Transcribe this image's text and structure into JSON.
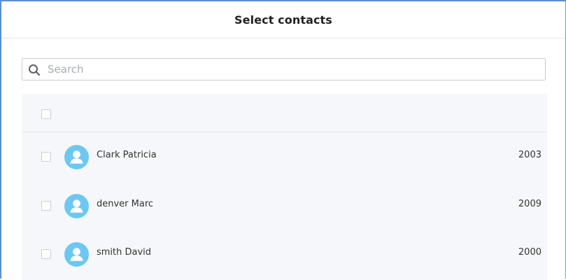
{
  "dialog": {
    "title": "Select contacts"
  },
  "search": {
    "placeholder": "Search",
    "value": "",
    "icon": "search-icon"
  },
  "colors": {
    "accent_border": "#5b8fd0",
    "avatar": "#6cc8f2",
    "panel_bg": "#f6f7fa"
  },
  "contacts": [
    {
      "name": "Clark Patricia",
      "year": "2003",
      "avatar_icon": "user-avatar-icon",
      "checked": false
    },
    {
      "name": "denver Marc",
      "year": "2009",
      "avatar_icon": "user-avatar-icon",
      "checked": false
    },
    {
      "name": "smith David",
      "year": "2000",
      "avatar_icon": "user-avatar-icon",
      "checked": false
    }
  ]
}
